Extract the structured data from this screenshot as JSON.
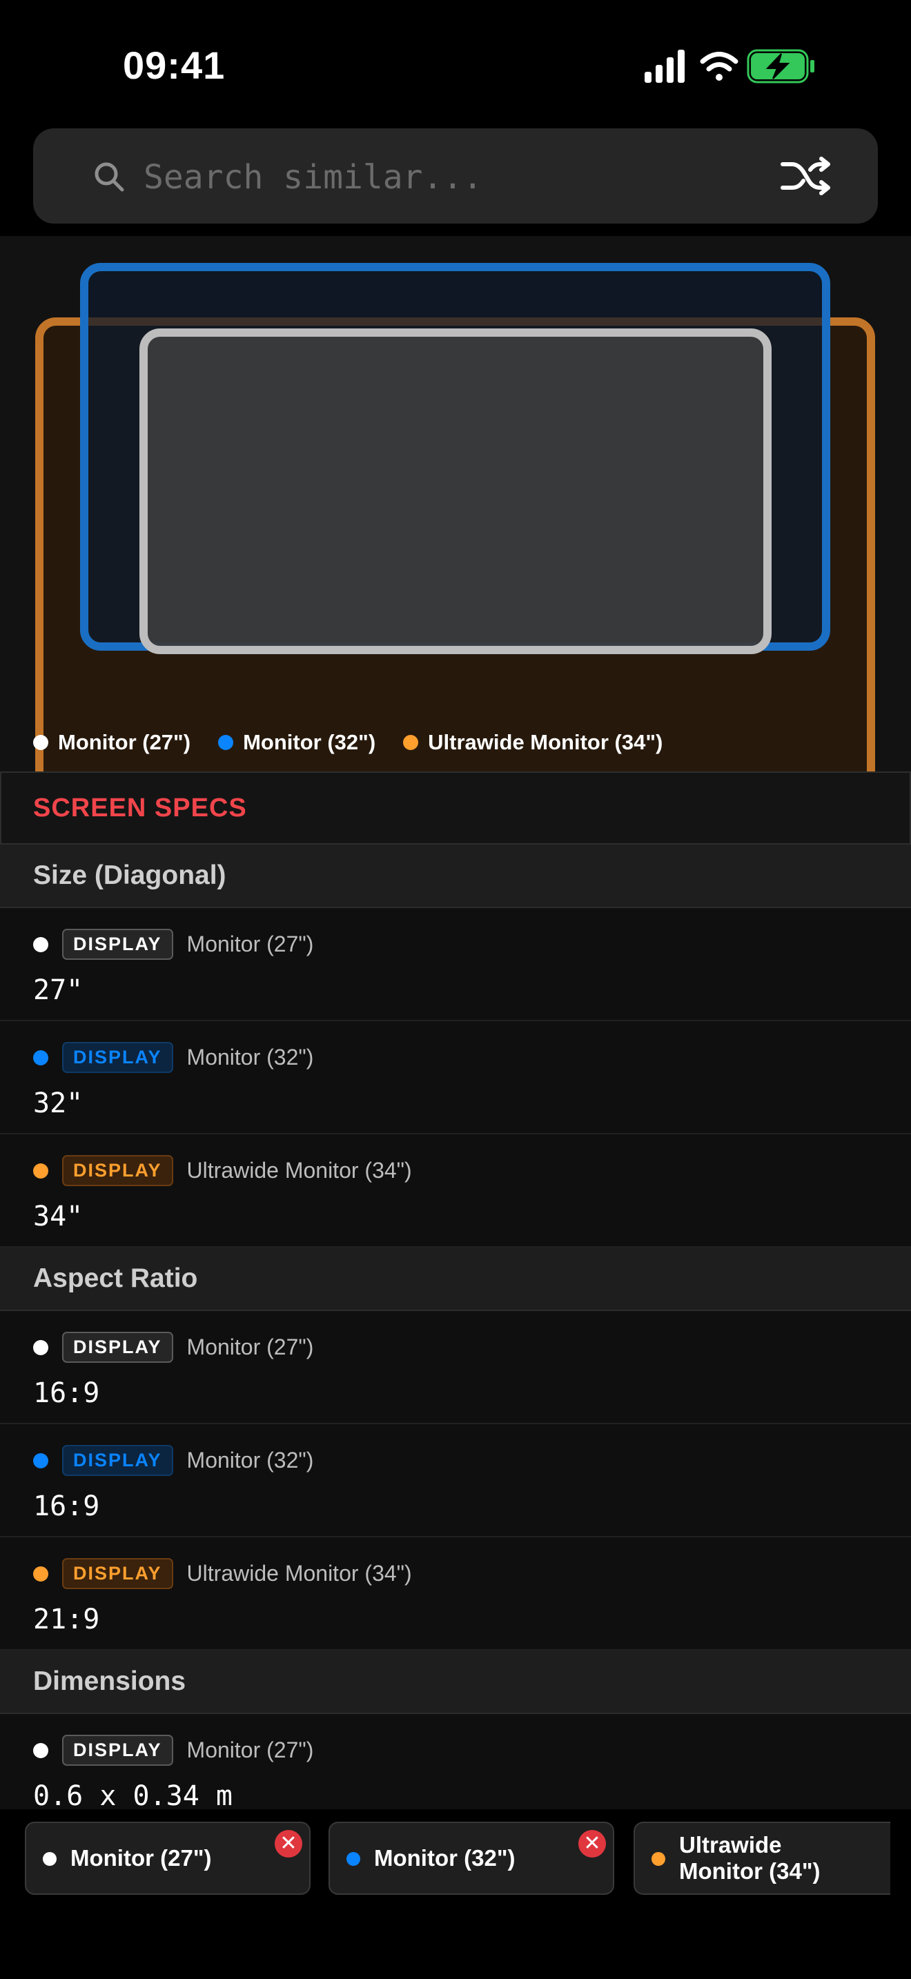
{
  "status_bar": {
    "time": "09:41"
  },
  "search": {
    "placeholder": "Search similar...",
    "icon": "search-icon",
    "action_icon": "shuffle-icon"
  },
  "colors": {
    "monitor_27": "#ffffff",
    "monitor_32": "#0a84ff",
    "ultrawide_34": "#ff9f2e",
    "section_title": "#f0454b",
    "battery_fill": "#34c759"
  },
  "legend": [
    {
      "label": "Monitor (27\")",
      "color": "#ffffff"
    },
    {
      "label": "Monitor (32\")",
      "color": "#0a84ff"
    },
    {
      "label": "Ultrawide Monitor (34\")",
      "color": "#ff9f2e"
    }
  ],
  "specs": {
    "section_title": "SCREEN SPECS",
    "groups": [
      {
        "title": "Size (Diagonal)",
        "rows": [
          {
            "badge": "DISPLAY",
            "name": "Monitor (27\")",
            "value": "27\""
          },
          {
            "badge": "DISPLAY",
            "name": "Monitor (32\")",
            "value": "32\""
          },
          {
            "badge": "DISPLAY",
            "name": "Ultrawide Monitor (34\")",
            "value": "34\""
          }
        ]
      },
      {
        "title": "Aspect Ratio",
        "rows": [
          {
            "badge": "DISPLAY",
            "name": "Monitor (27\")",
            "value": "16:9"
          },
          {
            "badge": "DISPLAY",
            "name": "Monitor (32\")",
            "value": "16:9"
          },
          {
            "badge": "DISPLAY",
            "name": "Ultrawide Monitor (34\")",
            "value": "21:9"
          }
        ]
      },
      {
        "title": "Dimensions",
        "rows": [
          {
            "badge": "DISPLAY",
            "name": "Monitor (27\")",
            "value": "0.6 x 0.34 m"
          }
        ]
      }
    ]
  },
  "tray": {
    "chips": [
      {
        "label": "Monitor (27\")",
        "color": "#ffffff",
        "close_icon": "close-icon"
      },
      {
        "label": "Monitor (32\")",
        "color": "#0a84ff",
        "close_icon": "close-icon"
      },
      {
        "label": "Ultrawide Monitor (34\")",
        "color": "#ff9f2e"
      }
    ]
  }
}
